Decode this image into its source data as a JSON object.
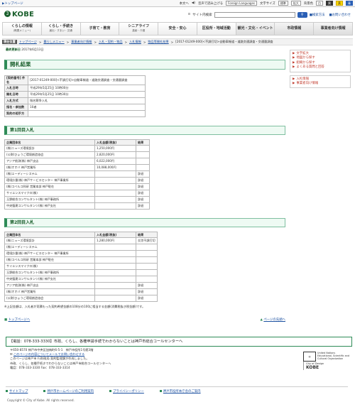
{
  "topbar": {
    "to_top": "トップページ",
    "text_mode": "本文へ",
    "voice": "音声で読み上げる",
    "foreign_languages": "Foreign Languages",
    "font_size_label": "文字サイズ",
    "size_standard": "標準",
    "size_large": "拡大",
    "bg_color_label": "背景色",
    "bg_white": "白",
    "bg_black": "黒",
    "bg_yellow": "黄",
    "bg_blue": "青"
  },
  "header": {
    "logo_text": "KOBE",
    "search_label": "サイト内検索",
    "search_placeholder": "",
    "search_button": "検索",
    "search_help": "検索方法",
    "contact": "お問い合わせ"
  },
  "gnav": [
    {
      "label": "くらしの情報",
      "sub": "(概要メニュー)"
    },
    {
      "label": "くらし・手続き",
      "sub": "届出・すまい・交通"
    },
    {
      "label": "子育て・教育",
      "sub": ""
    },
    {
      "label": "シニアライフ",
      "sub": "高齢・介護"
    },
    {
      "label": "安全・安心",
      "sub": ""
    },
    {
      "label": "区役所・地域活動",
      "sub": ""
    },
    {
      "label": "観光・文化・イベント",
      "sub": ""
    },
    {
      "label": "市政情報",
      "sub": ""
    },
    {
      "label": "事業者向け情報",
      "sub": ""
    }
  ],
  "breadcrumb": {
    "here": "現在位置",
    "items": [
      "トップページ",
      "暮らしメニュー",
      "事業者向け情報",
      "入札・契約・物品",
      "入札情報",
      "物品等開札結果",
      "[2017-01249-000]<不調打切>自動車報道・道路交通調査・交通量調査"
    ]
  },
  "updated": {
    "label": "最終更新日",
    "date": "2017年6月13日"
  },
  "page_title": "開札結果",
  "info_table": [
    {
      "h": "[契約番号] 件名",
      "v": "[2017-01249-000]<不調打切>自動車報道・道路交通調査・交通量調査"
    },
    {
      "h": "入札日時",
      "v": "平成29年5月25日 10時00分"
    },
    {
      "h": "開札日時",
      "v": "平成29年5月25日 10時30分"
    },
    {
      "h": "入札方式",
      "v": "指名競争入札"
    },
    {
      "h": "指名・参加数",
      "v": "10者"
    },
    {
      "h": "契約の相手方",
      "v": ""
    }
  ],
  "round1": {
    "title": "第1回目入札",
    "headers": [
      "企業団体名",
      "入札金額(税抜)",
      "結果"
    ],
    "rows": [
      [
        "(株)ニューズ環境設計",
        "1,250,000円",
        ""
      ],
      [
        "(公財)ひょうご環境創造協会",
        "2,820,000円",
        ""
      ],
      [
        "アジア航測(株) 神戸支店",
        "6,022,000円",
        ""
      ],
      [
        "(株)オオバ 神戸営業所",
        "10,088,000円",
        ""
      ],
      [
        "(株)エーディーシステム",
        "",
        "辞退"
      ],
      [
        "環境計量(株) 神戸サービスセンター 神戸事業所",
        "",
        "辞退"
      ],
      [
        "(株)コベルコ科研 営業本部 神戸駐在",
        "",
        "辞退"
      ],
      [
        "サイエンスマイクロ(株)",
        "",
        "辞退"
      ],
      [
        "玉野総合コンサルタント(株) 神戸事務所",
        "",
        "辞退"
      ],
      [
        "中央復建コンサルタンツ(株) 神戸支社",
        "",
        "辞退"
      ]
    ]
  },
  "round2": {
    "title": "第2回目入札",
    "headers": [
      "企業団体名",
      "入札金額(税抜)",
      "結果"
    ],
    "rows": [
      [
        "(株)ニューズ環境設計",
        "1,280,000円",
        "交渉不調打切"
      ],
      [
        "(株)エーディーシステム",
        "",
        ""
      ],
      [
        "環境計量(株) 神戸サービスセンター 神戸事業所",
        "",
        ""
      ],
      [
        "(株)コベルコ科研 営業本部 神戸駐在",
        "",
        ""
      ],
      [
        "サイエンスマイクロ(株)",
        "",
        ""
      ],
      [
        "玉野総合コンサルタント(株) 神戸事務所",
        "",
        ""
      ],
      [
        "中央復建コンサルタンツ(株) 神戸支社",
        "",
        ""
      ],
      [
        "アジア航測(株) 神戸支店",
        "",
        "辞退"
      ],
      [
        "(株)オオバ 神戸営業所",
        "",
        "辞退"
      ],
      [
        "(公財)ひょうご環境創造協会",
        "",
        "辞退"
      ]
    ]
  },
  "note": "※上記金額は、入札者が見積もった契約希望金額の108分の100に相当する金額(消費税抜き税金額)です。",
  "pagenav": {
    "top": "トップページへ",
    "up": "ページの先頭へ"
  },
  "sidebar": {
    "box1": [
      "文字拡大",
      "地図から探す",
      "組織から探す",
      "よくある質問と回答"
    ],
    "box2": [
      "入札情報",
      "事業者向け情報"
    ]
  },
  "footer": {
    "contact": "【電話：078-333-3330】市政、くらし、各種申請手続でわからないことは神戸市総合コールセンターへ",
    "addr_lines": [
      "〒650-8570 神戸市中央区加納町6-5-1　神戸市役所1号館3階",
      "このページの内容についてメールでお問い合わせする",
      "このページは神戸市 行財政局 契約監理課が作成しました。",
      "市政、くらし、各種手続きでわからないことは神戸市総合コールセンターへ",
      "電話：078-333-3330 Fax：078-333-3314"
    ],
    "unesco_text": [
      "United Nations",
      "Educational, Scientific and",
      "Cultural Organization"
    ],
    "city_of_design": "City of Design",
    "kobe": "KOBE",
    "links": [
      "サイトマップ",
      "神戸市ホームページのご利用案内",
      "プライバシーポリシー",
      "神戸市役所本庁舎のご案内"
    ],
    "copyright": "Copyright © City of Kobe. All rights reserved."
  }
}
